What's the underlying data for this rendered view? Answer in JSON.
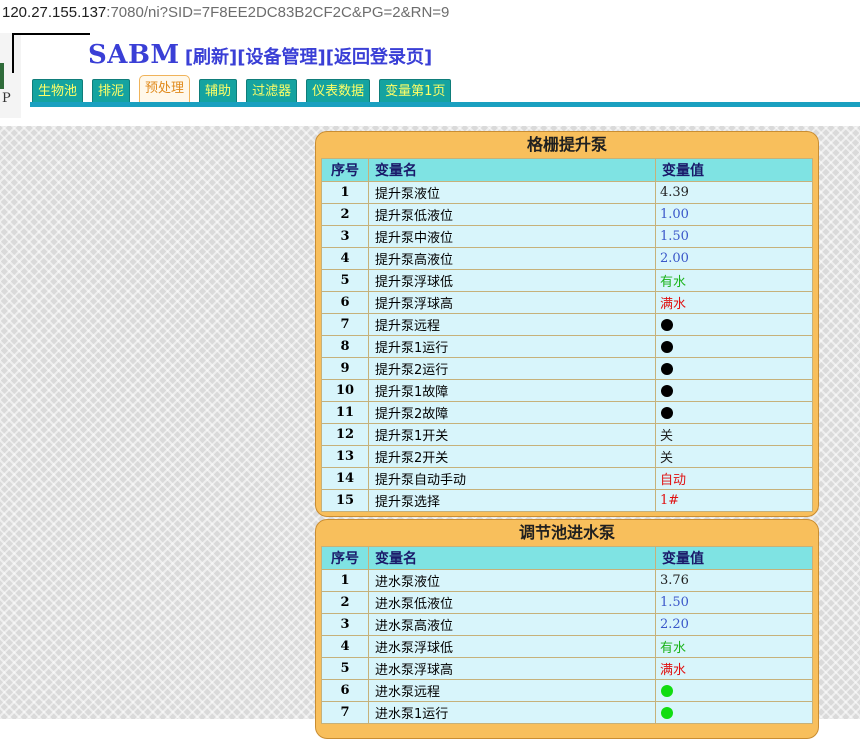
{
  "address_bar": {
    "host": "120.27.155.137",
    "rest": ":7080/ni?SID=7F8EE2DC83B2CF2C&PG=2&RN=9"
  },
  "logo_fragment": {
    "letter": "P"
  },
  "header": {
    "brand": "SABM",
    "links": [
      "[刷新]",
      "[设备管理]",
      "[返回登录页]"
    ]
  },
  "tabs": [
    {
      "label": "生物池",
      "active": false
    },
    {
      "label": "排泥",
      "active": false
    },
    {
      "label": "预处理",
      "active": true
    },
    {
      "label": "辅助",
      "active": false
    },
    {
      "label": "过滤器",
      "active": false
    },
    {
      "label": "仪表数据",
      "active": false
    },
    {
      "label": "变量第1页",
      "active": false
    }
  ],
  "colors": {
    "tab_bg": "#15a3a0",
    "tab_text": "#ffff66",
    "panel_bg": "#f8bf5c",
    "header_row": "#7fe3e3",
    "row_bg": "#d8f5fb",
    "value_blue": "#3b58c9",
    "value_green": "#1bb31b",
    "value_red": "#e01010"
  },
  "panels": [
    {
      "title": "格栅提升泵",
      "columns": [
        "序号",
        "变量名",
        "变量值"
      ],
      "rows": [
        {
          "no": "1",
          "name": "提升泵液位",
          "value": "4.39",
          "kind": "text",
          "color": "black"
        },
        {
          "no": "2",
          "name": "提升泵低液位",
          "value": "1.00",
          "kind": "text",
          "color": "blue"
        },
        {
          "no": "3",
          "name": "提升泵中液位",
          "value": "1.50",
          "kind": "text",
          "color": "blue"
        },
        {
          "no": "4",
          "name": "提升泵高液位",
          "value": "2.00",
          "kind": "text",
          "color": "blue"
        },
        {
          "no": "5",
          "name": "提升泵浮球低",
          "value": "有水",
          "kind": "text",
          "color": "green"
        },
        {
          "no": "6",
          "name": "提升泵浮球高",
          "value": "满水",
          "kind": "text",
          "color": "red"
        },
        {
          "no": "7",
          "name": "提升泵远程",
          "value": "black-dot-indicator",
          "kind": "dot",
          "color": "black"
        },
        {
          "no": "8",
          "name": "提升泵1运行",
          "value": "black-dot-indicator",
          "kind": "dot",
          "color": "black"
        },
        {
          "no": "9",
          "name": "提升泵2运行",
          "value": "black-dot-indicator",
          "kind": "dot",
          "color": "black"
        },
        {
          "no": "10",
          "name": "提升泵1故障",
          "value": "black-dot-indicator",
          "kind": "dot",
          "color": "black"
        },
        {
          "no": "11",
          "name": "提升泵2故障",
          "value": "black-dot-indicator",
          "kind": "dot",
          "color": "black"
        },
        {
          "no": "12",
          "name": "提升泵1开关",
          "value": "关",
          "kind": "text",
          "color": "black"
        },
        {
          "no": "13",
          "name": "提升泵2开关",
          "value": "关",
          "kind": "text",
          "color": "black"
        },
        {
          "no": "14",
          "name": "提升泵自动手动",
          "value": "自动",
          "kind": "text",
          "color": "red"
        },
        {
          "no": "15",
          "name": "提升泵选择",
          "value": "1#",
          "kind": "text",
          "color": "red"
        }
      ]
    },
    {
      "title": "调节池进水泵",
      "columns": [
        "序号",
        "变量名",
        "变量值"
      ],
      "rows": [
        {
          "no": "1",
          "name": "进水泵液位",
          "value": "3.76",
          "kind": "text",
          "color": "black"
        },
        {
          "no": "2",
          "name": "进水泵低液位",
          "value": "1.50",
          "kind": "text",
          "color": "blue"
        },
        {
          "no": "3",
          "name": "进水泵高液位",
          "value": "2.20",
          "kind": "text",
          "color": "blue"
        },
        {
          "no": "4",
          "name": "进水泵浮球低",
          "value": "有水",
          "kind": "text",
          "color": "green"
        },
        {
          "no": "5",
          "name": "进水泵浮球高",
          "value": "满水",
          "kind": "text",
          "color": "red"
        },
        {
          "no": "6",
          "name": "进水泵远程",
          "value": "green-dot-indicator",
          "kind": "dot",
          "color": "green"
        },
        {
          "no": "7",
          "name": "进水泵1运行",
          "value": "green-dot-indicator",
          "kind": "dot",
          "color": "green"
        }
      ]
    }
  ]
}
